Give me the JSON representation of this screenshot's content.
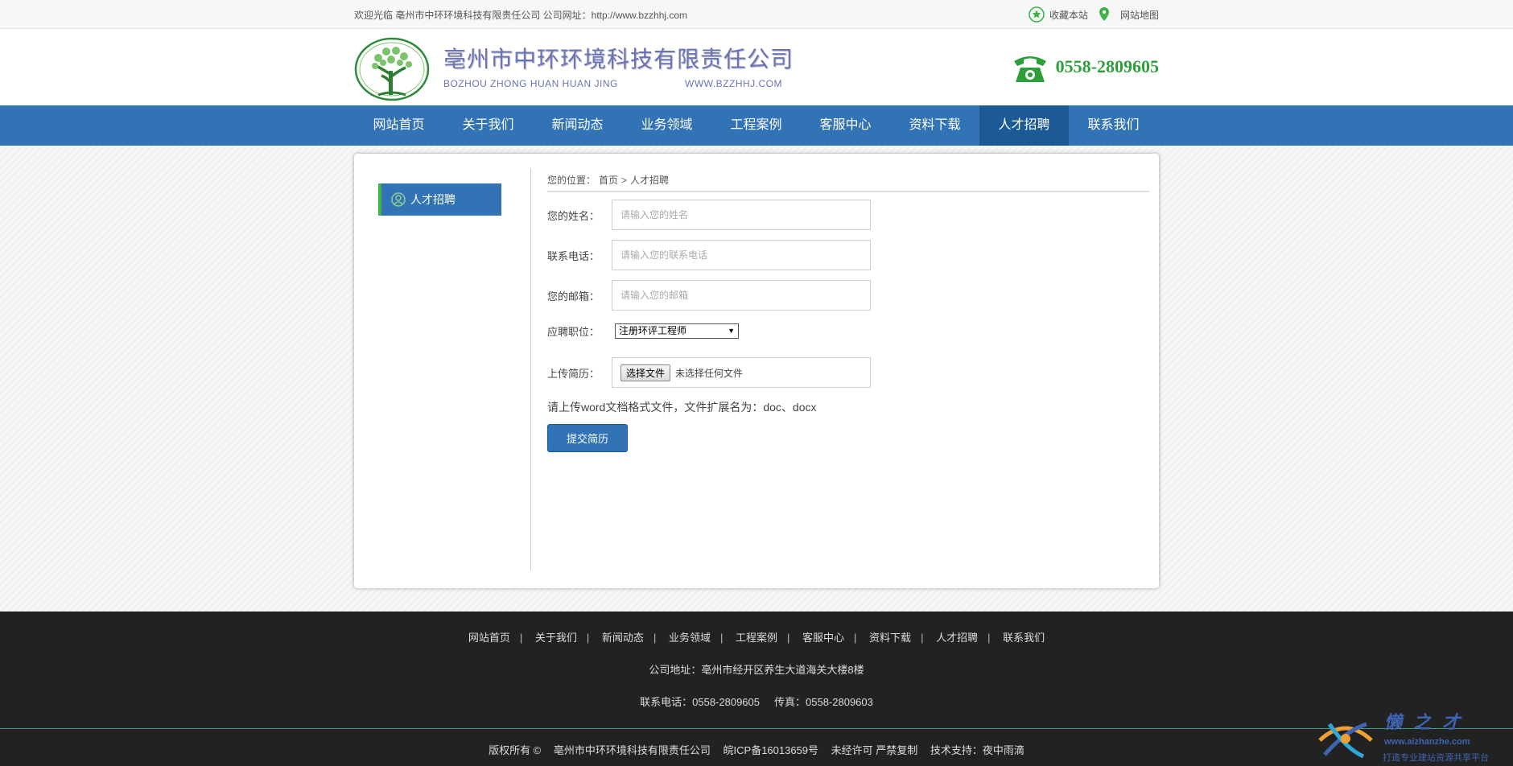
{
  "topbar": {
    "welcome": "欢迎光临 亳州市中环环境科技有限责任公司 公司网址：http://www.bzzhhj.com",
    "favorite": "收藏本站",
    "sitemap": "网站地图"
  },
  "header": {
    "company_cn": "亳州市中环环境科技有限责任公司",
    "company_en": "BOZHOU ZHONG HUAN HUAN JING",
    "website": "WWW.BZZHHJ.COM",
    "phone": "0558-2809605"
  },
  "nav": {
    "items": [
      "网站首页",
      "关于我们",
      "新闻动态",
      "业务领域",
      "工程案例",
      "客服中心",
      "资料下载",
      "人才招聘",
      "联系我们"
    ],
    "active": "人才招聘"
  },
  "sidebar": {
    "item": "人才招聘"
  },
  "breadcrumb": {
    "prefix": "您的位置：",
    "home": "首页",
    "sep": ">",
    "current": "人才招聘"
  },
  "form": {
    "name_label": "您的姓名：",
    "name_placeholder": "请输入您的姓名",
    "phone_label": "联系电话：",
    "phone_placeholder": "请输入您的联系电话",
    "email_label": "您的邮箱：",
    "email_placeholder": "请输入您的邮箱",
    "position_label": "应聘职位：",
    "position_value": "注册环评工程师",
    "upload_label": "上传简历：",
    "file_button": "选择文件",
    "file_status": "未选择任何文件",
    "hint": "请上传word文档格式文件，文件扩展名为：doc、docx",
    "submit": "提交简历"
  },
  "footer": {
    "nav": [
      "网站首页",
      "关于我们",
      "新闻动态",
      "业务领域",
      "工程案例",
      "客服中心",
      "资料下载",
      "人才招聘",
      "联系我们"
    ],
    "separator": "|",
    "address": "公司地址：亳州市经开区养生大道海关大楼8楼",
    "tel": "联系电话：0558-2809605",
    "fax": "传真：0558-2809603",
    "copyright": "版权所有 ©",
    "company": "亳州市中环环境科技有限责任公司",
    "icp": "皖ICP备16013659号",
    "notice": "未经许可 严禁复制",
    "support": "技术支持：夜中雨滴"
  },
  "watermark": {
    "title": "懒之才",
    "url": "www.aizhanzhe.com",
    "slogan": "打造专业建站资源共享平台"
  },
  "colors": {
    "nav_bg": "#3173b5",
    "nav_active": "#1c5a97",
    "accent_green": "#3fb34a",
    "phone_green": "#2e9e3a",
    "brand_purple": "#6a73b8",
    "footer_bg": "#222222"
  }
}
